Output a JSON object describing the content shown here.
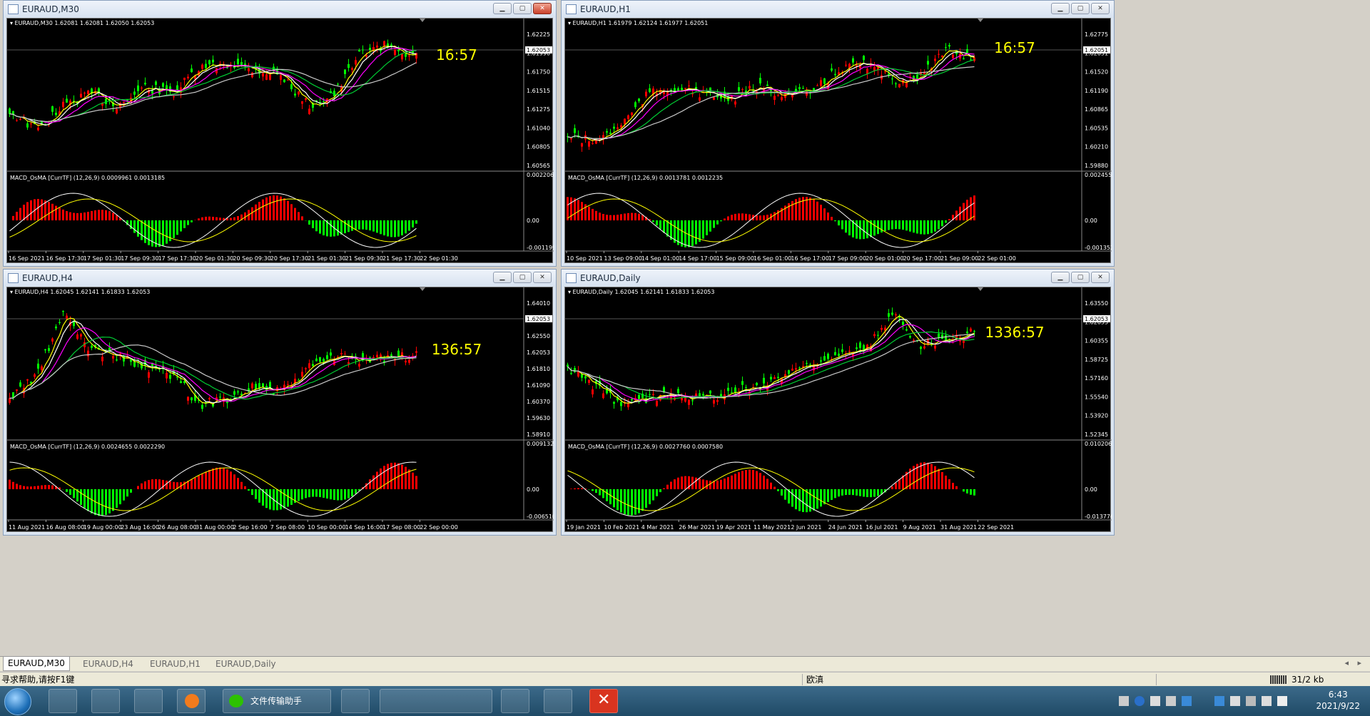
{
  "colors": {
    "chart_bg": "#000000",
    "candle_up": "#ff0000",
    "candle_down": "#00ff00",
    "ma_yellow": "#ffff00",
    "ma_white": "#ffffff",
    "ma_magenta": "#ff00ff",
    "ma_green": "#00cc33",
    "ma_gray": "#c8c8c8",
    "hist_pos": "#ff0000",
    "hist_neg": "#00ff00",
    "countdown": "#ffff00",
    "grid_text": "#ffffff"
  },
  "windows": [
    {
      "id": "m30",
      "title": "EURAUD,M30",
      "header": "EURAUD,M30  1.62081 1.62081 1.62050 1.62053",
      "timer": "16:57",
      "macd_header": "MACD_OsMA [CurrTF] (12,26,9) 0.0009961 0.0013185",
      "price_axis": [
        "1.62225",
        "1.61990",
        "1.61750",
        "1.61515",
        "1.61275",
        "1.61040",
        "1.60805",
        "1.60565"
      ],
      "current_price": "1.62053",
      "macd_axis": [
        "0.0022064",
        "0.00",
        "-0.001199"
      ],
      "time_axis": [
        "16 Sep 2021",
        "16 Sep 17:30",
        "17 Sep 01:30",
        "17 Sep 09:30",
        "17 Sep 17:30",
        "20 Sep 01:30",
        "20 Sep 09:30",
        "20 Sep 17:30",
        "21 Sep 01:30",
        "21 Sep 09:30",
        "21 Sep 17:30",
        "22 Sep 01:30"
      ]
    },
    {
      "id": "h1",
      "title": "EURAUD,H1",
      "header": "EURAUD,H1  1.61979 1.62124 1.61977 1.62051",
      "timer": "16:57",
      "macd_header": "MACD_OsMA [CurrTF] (12,26,9) 0.0013781 0.0012235",
      "price_axis": [
        "1.62775",
        "1.62051",
        "1.61520",
        "1.61190",
        "1.60865",
        "1.60535",
        "1.60210",
        "1.59880"
      ],
      "current_price": "1.62051",
      "macd_axis": [
        "0.0024551",
        "0.00",
        "-0.001352"
      ],
      "time_axis": [
        "10 Sep 2021",
        "13 Sep 09:00",
        "14 Sep 01:00",
        "14 Sep 17:00",
        "15 Sep 09:00",
        "16 Sep 01:00",
        "16 Sep 17:00",
        "17 Sep 09:00",
        "20 Sep 01:00",
        "20 Sep 17:00",
        "21 Sep 09:00",
        "22 Sep 01:00"
      ]
    },
    {
      "id": "h4",
      "title": "EURAUD,H4",
      "header": "EURAUD,H4  1.62045 1.62141 1.61833 1.62053",
      "timer": "136:57",
      "macd_header": "MACD_OsMA [CurrTF] (12,26,9) 0.0024655 0.0022290",
      "price_axis": [
        "1.64010",
        "1.63270",
        "1.62550",
        "1.62053",
        "1.61810",
        "1.61090",
        "1.60370",
        "1.59630",
        "1.58910"
      ],
      "current_price": "1.62053",
      "macd_axis": [
        "0.0091321",
        "0.00",
        "-0.006510"
      ],
      "time_axis": [
        "11 Aug 2021",
        "16 Aug 08:00",
        "19 Aug 00:00",
        "23 Aug 16:00",
        "26 Aug 08:00",
        "31 Aug 00:00",
        "2 Sep 16:00",
        "7 Sep 08:00",
        "10 Sep 00:00",
        "14 Sep 16:00",
        "17 Sep 08:00",
        "22 Sep 00:00"
      ]
    },
    {
      "id": "daily",
      "title": "EURAUD,Daily",
      "header": "EURAUD,Daily  1.62045 1.62141 1.61833 1.62053",
      "timer": "1336:57",
      "macd_header": "MACD_OsMA [CurrTF] (12,26,9) 0.0027760 0.0007580",
      "price_axis": [
        "1.63550",
        "1.62053",
        "1.60355",
        "1.58725",
        "1.57160",
        "1.55540",
        "1.53920",
        "1.52345"
      ],
      "current_price": "1.62053",
      "macd_axis": [
        "0.0102069",
        "0.00",
        "-0.013776"
      ],
      "time_axis": [
        "19 Jan 2021",
        "10 Feb 2021",
        "4 Mar 2021",
        "26 Mar 2021",
        "19 Apr 2021",
        "11 May 2021",
        "2 Jun 2021",
        "24 Jun 2021",
        "16 Jul 2021",
        "9 Aug 2021",
        "31 Aug 2021",
        "22 Sep 2021"
      ]
    }
  ],
  "tabs": [
    "EURAUD,M30",
    "EURAUD,H4",
    "EURAUD,H1",
    "EURAUD,Daily"
  ],
  "status": {
    "help": "寻求帮助,请按F1键",
    "profile": "欧滇",
    "traffic": "31/2 kb"
  },
  "taskbar": {
    "app_wechat": "文件传输助手",
    "time": "6:43",
    "date": "2021/9/22"
  }
}
